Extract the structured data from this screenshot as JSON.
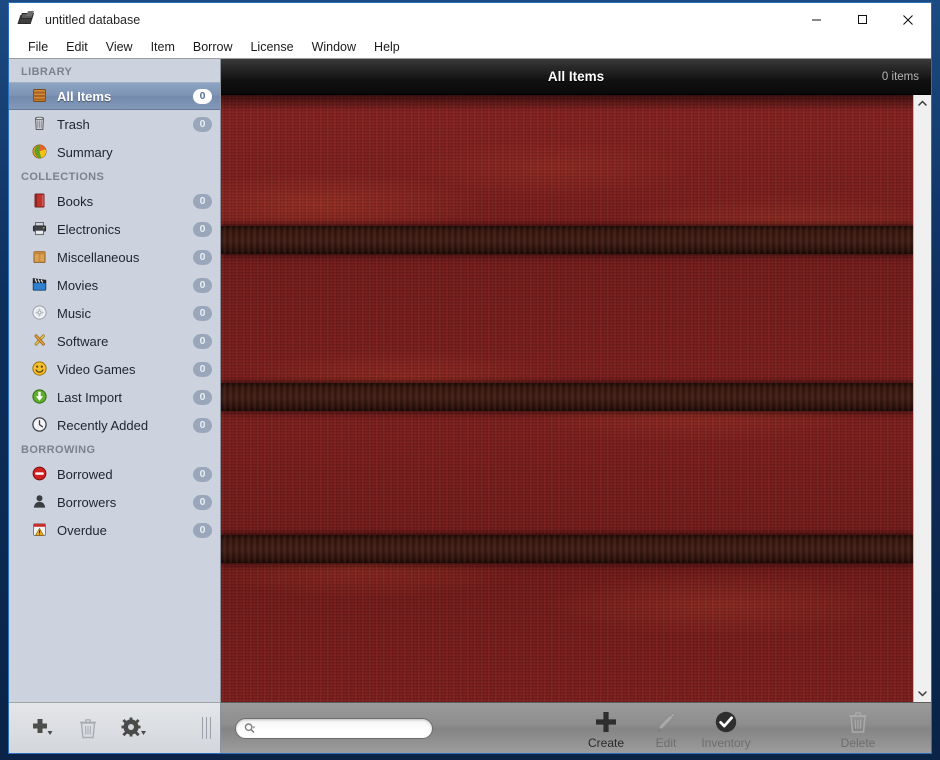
{
  "window": {
    "title": "untitled database",
    "controls": {
      "minimize": "—",
      "maximize": "□",
      "close": "✕"
    }
  },
  "menubar": {
    "items": [
      {
        "label": "File"
      },
      {
        "label": "Edit"
      },
      {
        "label": "View"
      },
      {
        "label": "Item"
      },
      {
        "label": "Borrow"
      },
      {
        "label": "License"
      },
      {
        "label": "Window"
      },
      {
        "label": "Help"
      }
    ]
  },
  "sidebar": {
    "groups": [
      {
        "title": "LIBRARY",
        "items": [
          {
            "label": "All Items",
            "count": "0",
            "icon": "library-box-icon",
            "selected": true
          },
          {
            "label": "Trash",
            "count": "0",
            "icon": "trash-can-icon",
            "selected": false
          },
          {
            "label": "Summary",
            "count": "",
            "icon": "pie-chart-icon",
            "selected": false
          }
        ]
      },
      {
        "title": "COLLECTIONS",
        "items": [
          {
            "label": "Books",
            "count": "0",
            "icon": "book-icon",
            "selected": false
          },
          {
            "label": "Electronics",
            "count": "0",
            "icon": "printer-icon",
            "selected": false
          },
          {
            "label": "Miscellaneous",
            "count": "0",
            "icon": "box-icon",
            "selected": false
          },
          {
            "label": "Movies",
            "count": "0",
            "icon": "clapperboard-icon",
            "selected": false
          },
          {
            "label": "Music",
            "count": "0",
            "icon": "cd-disc-icon",
            "selected": false
          },
          {
            "label": "Software",
            "count": "0",
            "icon": "crossed-tools-icon",
            "selected": false
          },
          {
            "label": "Video Games",
            "count": "0",
            "icon": "smiley-face-icon",
            "selected": false
          },
          {
            "label": "Last Import",
            "count": "0",
            "icon": "green-download-icon",
            "selected": false
          },
          {
            "label": "Recently Added",
            "count": "0",
            "icon": "clock-icon",
            "selected": false
          }
        ]
      },
      {
        "title": "BORROWING",
        "items": [
          {
            "label": "Borrowed",
            "count": "0",
            "icon": "no-entry-icon",
            "selected": false
          },
          {
            "label": "Borrowers",
            "count": "0",
            "icon": "person-icon",
            "selected": false
          },
          {
            "label": "Overdue",
            "count": "0",
            "icon": "calendar-warning-icon",
            "selected": false
          }
        ]
      }
    ],
    "bottom_buttons": [
      {
        "name": "add",
        "icon": "plus-dropdown-icon"
      },
      {
        "name": "delete",
        "icon": "trash-icon"
      },
      {
        "name": "settings",
        "icon": "gear-dropdown-icon"
      }
    ]
  },
  "main": {
    "header_title": "All Items",
    "item_count": "0 items"
  },
  "search": {
    "value": "",
    "placeholder": "",
    "icon": "search-magnifier-icon"
  },
  "toolbar": {
    "buttons": [
      {
        "label": "Create",
        "icon": "plus-icon",
        "enabled": true
      },
      {
        "label": "Edit",
        "icon": "pencil-icon",
        "enabled": false
      },
      {
        "label": "Inventory",
        "icon": "check-circle-icon",
        "enabled": false
      },
      {
        "label": "Delete",
        "icon": "trash-icon",
        "enabled": false
      }
    ]
  },
  "scrollbar": {
    "up_arrow": "chevron-up-icon",
    "down_arrow": "chevron-down-icon"
  },
  "colors": {
    "sidebar_bg": "#ccd3de",
    "selection": "#7d93b4",
    "shelf_wood": "#8a2222",
    "shelf_band": "#3a1a11",
    "header_bar": "#111111",
    "badge": "#9aa7bb"
  }
}
